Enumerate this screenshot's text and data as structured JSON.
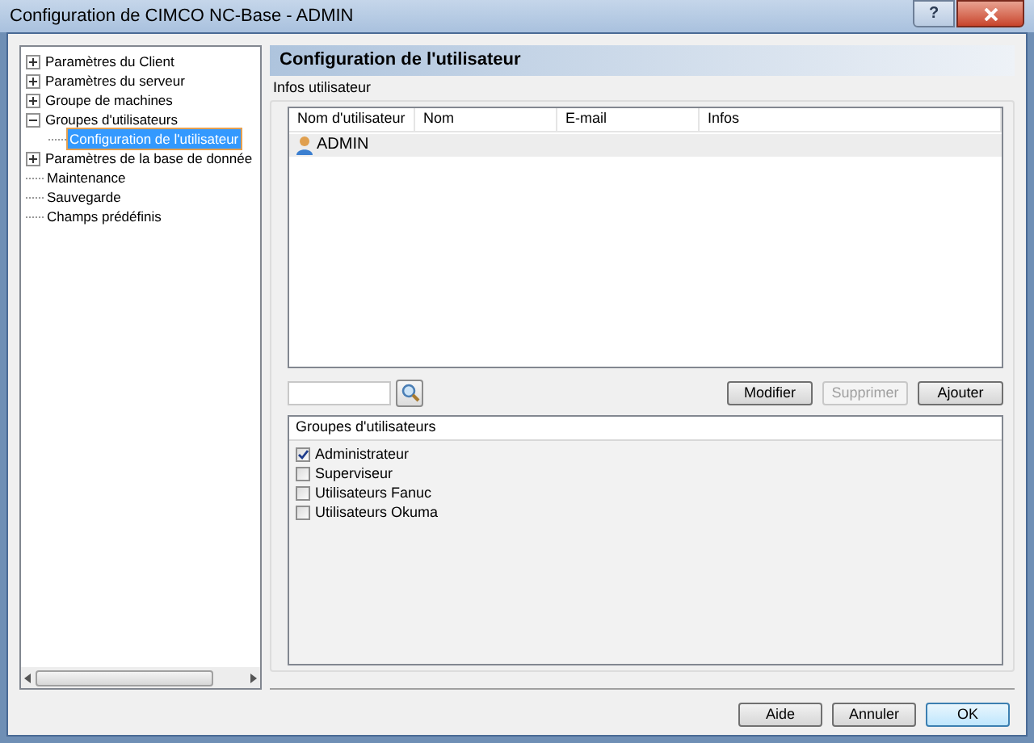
{
  "window": {
    "title": "Configuration de CIMCO NC-Base - ADMIN",
    "help_button": "?"
  },
  "tree": [
    {
      "label": "Paramètres du Client",
      "kind": "group",
      "expanded": false,
      "selected": false
    },
    {
      "label": "Paramètres du serveur",
      "kind": "group",
      "expanded": false,
      "selected": false
    },
    {
      "label": "Groupe de machines",
      "kind": "group",
      "expanded": false,
      "selected": false
    },
    {
      "label": "Groupes d'utilisateurs",
      "kind": "group",
      "expanded": true,
      "selected": false,
      "children": [
        {
          "label": "Configuration de l'utilisateur",
          "kind": "leaf",
          "selected": true
        }
      ]
    },
    {
      "label": "Paramètres de la base de donnée",
      "kind": "group",
      "expanded": false,
      "selected": false
    },
    {
      "label": "Maintenance",
      "kind": "leaf",
      "selected": false
    },
    {
      "label": "Sauvegarde",
      "kind": "leaf",
      "selected": false
    },
    {
      "label": "Champs prédéfinis",
      "kind": "leaf",
      "selected": false
    }
  ],
  "page_title": "Configuration de l'utilisateur",
  "user_info": {
    "title": "Infos utilisateur",
    "columns": [
      "Nom d'utilisateur",
      "Nom",
      "E-mail",
      "Infos"
    ],
    "rows": [
      {
        "username": "ADMIN",
        "selected": true
      }
    ]
  },
  "actions": [
    {
      "label": "Modifier",
      "disabled": false
    },
    {
      "label": "Supprimer",
      "disabled": true
    },
    {
      "label": "Ajouter",
      "disabled": false
    }
  ],
  "groups": {
    "title": "Groupes d'utilisateurs",
    "items": [
      {
        "label": "Administrateur",
        "checked": true
      },
      {
        "label": "Superviseur",
        "checked": false
      },
      {
        "label": "Utilisateurs Fanuc",
        "checked": false
      },
      {
        "label": "Utilisateurs Okuma",
        "checked": false
      }
    ]
  },
  "buttons": [
    {
      "label": "Aide",
      "default": false
    },
    {
      "label": "Annuler",
      "default": false
    },
    {
      "label": "OK",
      "default": true
    }
  ]
}
